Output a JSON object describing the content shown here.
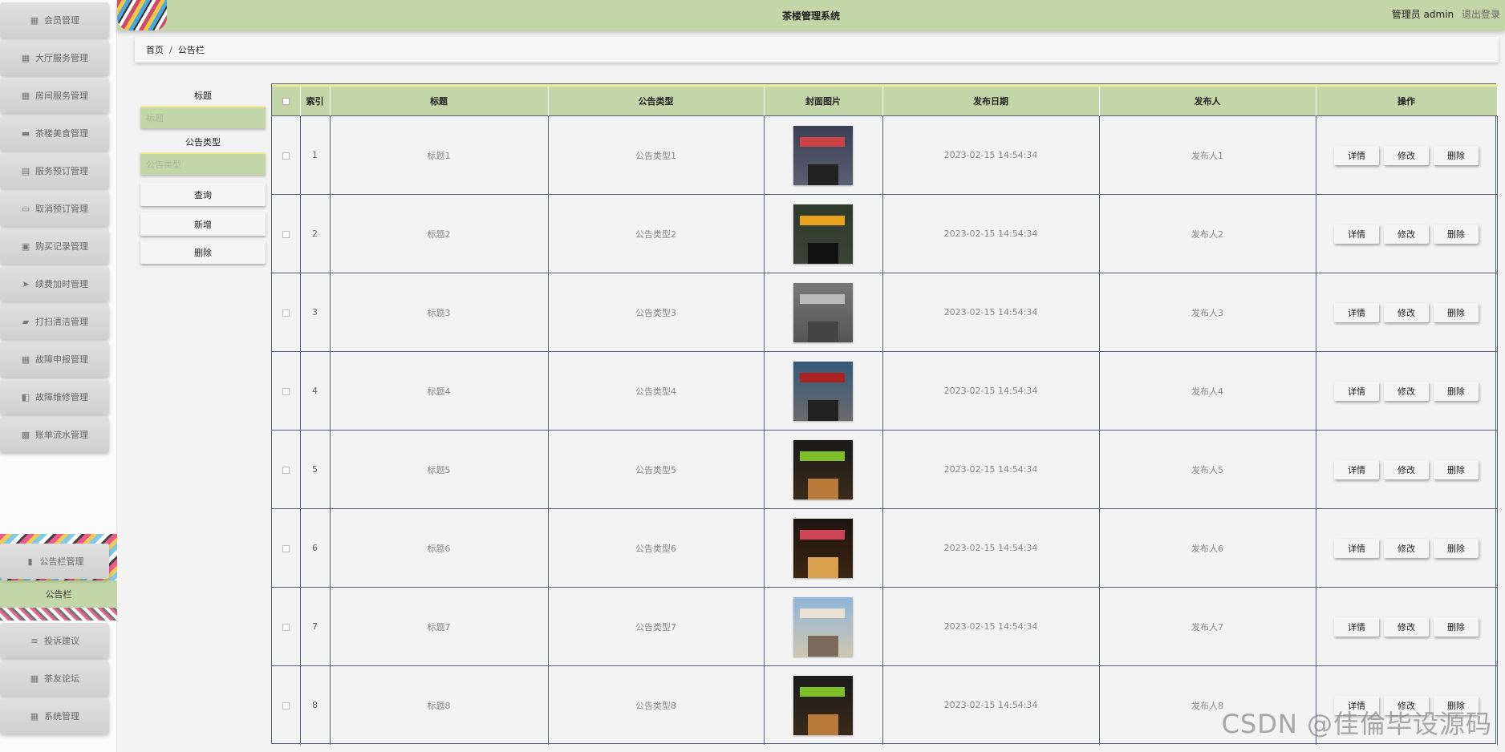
{
  "sidebar": {
    "items": [
      {
        "label": "会员管理",
        "icon": "grid-icon"
      },
      {
        "label": "大厅服务管理",
        "icon": "grid-icon"
      },
      {
        "label": "房间服务管理",
        "icon": "grid-icon"
      },
      {
        "label": "茶楼美食管理",
        "icon": "chat-icon"
      },
      {
        "label": "服务预订管理",
        "icon": "printer-icon"
      },
      {
        "label": "取消预订管理",
        "icon": "monitor-icon"
      },
      {
        "label": "购买记录管理",
        "icon": "clipboard-icon"
      },
      {
        "label": "续费加时管理",
        "icon": "send-icon"
      },
      {
        "label": "打扫清洁管理",
        "icon": "ticket-icon"
      },
      {
        "label": "故障申报管理",
        "icon": "grid-icon"
      },
      {
        "label": "故障维修管理",
        "icon": "tools-icon"
      },
      {
        "label": "账单流水管理",
        "icon": "grid-dots-icon"
      },
      {
        "label": "公告栏管理",
        "icon": "bar-chart-icon"
      },
      {
        "label": "投诉建议",
        "icon": "menu-icon"
      },
      {
        "label": "茶友论坛",
        "icon": "grid-icon"
      },
      {
        "label": "系统管理",
        "icon": "grid-icon"
      }
    ],
    "submenu": {
      "label": "公告栏"
    }
  },
  "header": {
    "title": "茶楼管理系统",
    "user": "管理员 admin",
    "logout": "退出登录"
  },
  "breadcrumb": {
    "home": "首页",
    "sep": "/",
    "current": "公告栏"
  },
  "search": {
    "title_label": "标题",
    "title_placeholder": "标题",
    "type_label": "公告类型",
    "type_placeholder": "公告类型",
    "query_btn": "查询",
    "add_btn": "新增",
    "delete_btn": "删除"
  },
  "table": {
    "columns": [
      "",
      "索引",
      "标题",
      "公告类型",
      "封面图片",
      "发布日期",
      "发布人",
      "操作"
    ],
    "actions": {
      "detail": "详情",
      "edit": "修改",
      "delete": "删除"
    },
    "rows": [
      {
        "index": "1",
        "title": "标题1",
        "type": "公告类型1",
        "date": "2023-02-15 14:54:34",
        "publisher": "发布人1"
      },
      {
        "index": "2",
        "title": "标题2",
        "type": "公告类型2",
        "date": "2023-02-15 14:54:34",
        "publisher": "发布人2"
      },
      {
        "index": "3",
        "title": "标题3",
        "type": "公告类型3",
        "date": "2023-02-15 14:54:34",
        "publisher": "发布人3"
      },
      {
        "index": "4",
        "title": "标题4",
        "type": "公告类型4",
        "date": "2023-02-15 14:54:34",
        "publisher": "发布人4"
      },
      {
        "index": "5",
        "title": "标题5",
        "type": "公告类型5",
        "date": "2023-02-15 14:54:34",
        "publisher": "发布人5"
      },
      {
        "index": "6",
        "title": "标题6",
        "type": "公告类型6",
        "date": "2023-02-15 14:54:34",
        "publisher": "发布人6"
      },
      {
        "index": "7",
        "title": "标题7",
        "type": "公告类型7",
        "date": "2023-02-15 14:54:34",
        "publisher": "发布人7"
      },
      {
        "index": "8",
        "title": "标题8",
        "type": "公告类型8",
        "date": "2023-02-15 14:54:34",
        "publisher": "发布人8"
      }
    ]
  },
  "colors": {
    "accent": "#c2d6a7",
    "accent_border": "#f2ec9a",
    "table_border": "#555d77"
  },
  "watermark": "CSDN @佳倫毕设源码"
}
